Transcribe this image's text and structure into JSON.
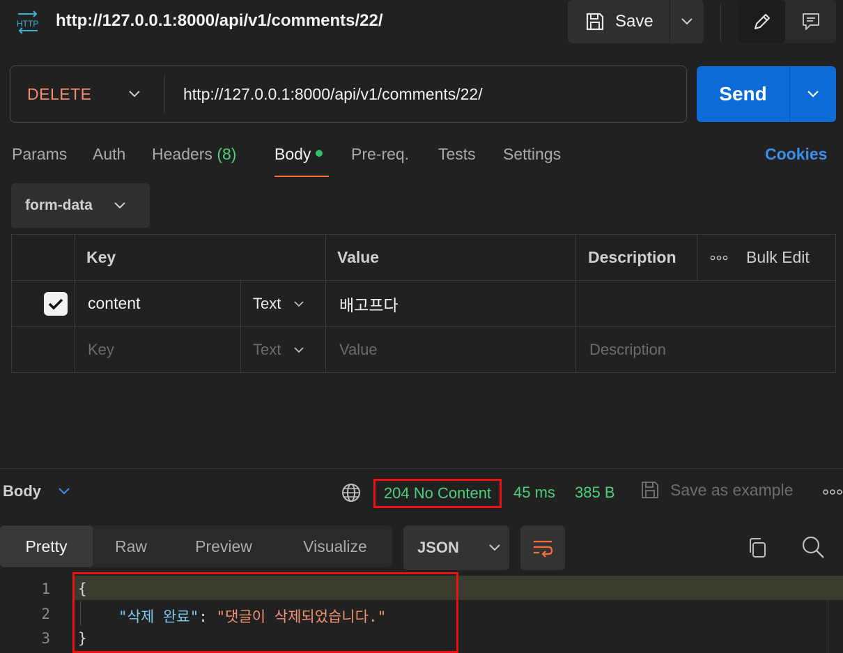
{
  "header": {
    "protocol_icon": "HTTP",
    "title": "http://127.0.0.1:8000/api/v1/comments/22/",
    "save_label": "Save"
  },
  "request": {
    "method": "DELETE",
    "url": "http://127.0.0.1:8000/api/v1/comments/22/",
    "send_label": "Send"
  },
  "tabs": {
    "params": "Params",
    "auth": "Auth",
    "headers": "Headers",
    "headers_count": "(8)",
    "body": "Body",
    "prereq": "Pre-req.",
    "tests": "Tests",
    "settings": "Settings",
    "cookies": "Cookies"
  },
  "body_mode": "form-data",
  "form_table": {
    "headers": {
      "key": "Key",
      "value": "Value",
      "description": "Description",
      "bulk_edit": "Bulk Edit"
    },
    "rows": [
      {
        "checked": true,
        "key": "content",
        "type": "Text",
        "value": "배고프다",
        "description": ""
      }
    ],
    "placeholder": {
      "key": "Key",
      "type": "Text",
      "value": "Value",
      "description": "Description"
    }
  },
  "response": {
    "section_label": "Body",
    "status": "204 No Content",
    "time": "45 ms",
    "size": "385 B",
    "save_example": "Save as example",
    "view_tabs": [
      "Pretty",
      "Raw",
      "Preview",
      "Visualize"
    ],
    "active_view": "Pretty",
    "format": "JSON",
    "code": {
      "line_numbers": [
        "1",
        "2",
        "3"
      ],
      "open_brace": "{",
      "key": "\"삭제 완료\"",
      "colon": ": ",
      "value": "\"댓글이 삭제되었습니다.\"",
      "close_brace": "}"
    }
  },
  "colors": {
    "method": "#f28b6e",
    "send": "#0c6bd6",
    "status_ok": "#4cd07d",
    "active_tab_underline": "#ff6c37",
    "cookies": "#3b8eea",
    "highlight_box": "#ee1111"
  }
}
